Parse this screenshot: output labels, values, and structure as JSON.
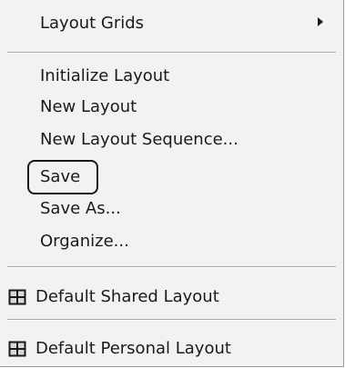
{
  "menu": {
    "layout_grids": {
      "label": "Layout Grids",
      "submenu_icon": "triangle-right-icon"
    },
    "items": [
      {
        "label": "Initialize Layout"
      },
      {
        "label": "New Layout"
      },
      {
        "label": "New Layout Sequence..."
      },
      {
        "label": "Save"
      },
      {
        "label": "Save As..."
      },
      {
        "label": "Organize..."
      }
    ],
    "highlighted_item": "Save",
    "layouts": [
      {
        "label": "Default Shared Layout",
        "icon": "grid-layout-icon"
      },
      {
        "label": "Default Personal Layout",
        "icon": "grid-layout-icon"
      }
    ]
  }
}
